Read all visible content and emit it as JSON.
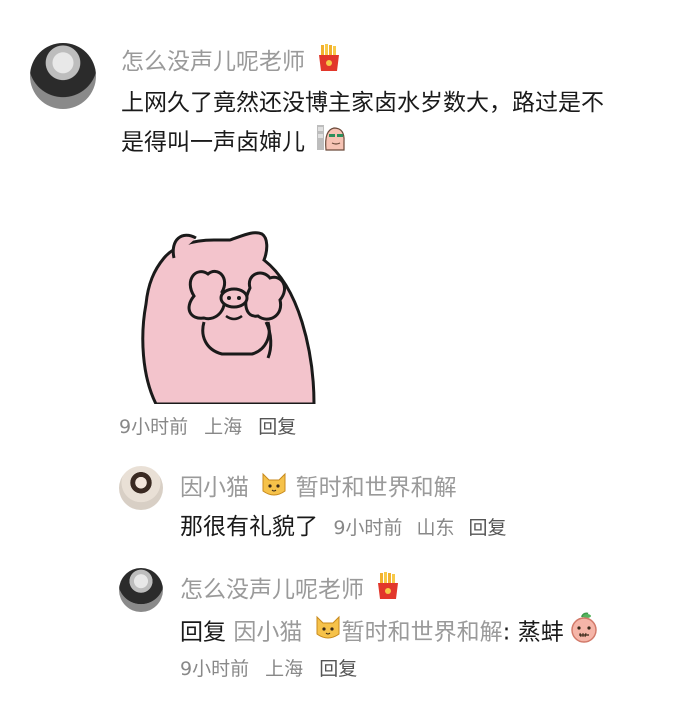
{
  "comment": {
    "username": "怎么没声儿呢老师",
    "text_line1": "上网久了竟然还没博主家卤水岁数大，路过是不",
    "text_line2": "是得叫一声卤婶儿",
    "time": "9小时前",
    "location": "上海",
    "reply_label": "回复",
    "emoji_after_name": "fries-icon",
    "sticker": "pink-pig-covering-eyes"
  },
  "replies": [
    {
      "username": "因小猫",
      "badge": "cat-icon",
      "username_suffix": "暂时和世界和解",
      "text": "那很有礼貌了",
      "time": "9小时前",
      "location": "山东",
      "reply_label": "回复"
    },
    {
      "username": "怎么没声儿呢老师",
      "prefix": "回复",
      "mention_name": "因小猫",
      "mention_suffix": "暂时和世界和解",
      "colon": ":",
      "text": "蒸蚌",
      "time": "9小时前",
      "location": "上海",
      "reply_label": "回复"
    }
  ]
}
